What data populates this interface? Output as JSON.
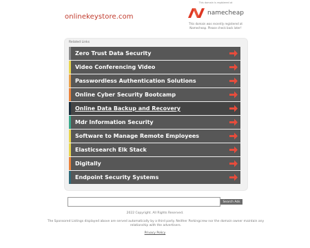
{
  "header": {
    "registrar_note": "This domain is registered at",
    "domain": "onlinekeystore.com",
    "brand_name": "namecheap",
    "recent_note": "This domain was recently registered at Namecheap. Please check back later!",
    "brand_color": "#de3723"
  },
  "related": {
    "title": "Related Links",
    "arrow_color": "#e74c3c",
    "links": [
      {
        "label": "Zero Trust Data Security",
        "stripe_color": "#8a8a8a"
      },
      {
        "label": "Video Conferencing Video",
        "stripe_color": "#e8d44d"
      },
      {
        "label": "Passwordless Authentication Solutions",
        "stripe_color": "#e9a24a"
      },
      {
        "label": "Online Cyber Security Bootcamp",
        "stripe_color": "#e9823a"
      },
      {
        "label": "Online Data Backup and Recovery",
        "stripe_color": "#1a2e3d"
      },
      {
        "label": "Mdr Information Security",
        "stripe_color": "#3aa88a"
      },
      {
        "label": "Software to Manage Remote Employees",
        "stripe_color": "#e8d44d"
      },
      {
        "label": "Elasticsearch Elk Stack",
        "stripe_color": "#e8d44d"
      },
      {
        "label": "Digitally",
        "stripe_color": "#e9823a"
      },
      {
        "label": "Endpoint Security Systems",
        "stripe_color": "#2d6a7a"
      }
    ],
    "active_index": 4
  },
  "search": {
    "placeholder": "",
    "button_label": "Search Ads"
  },
  "footer": {
    "copyright": "2022 Copyright. All Rights Reserved.",
    "disclaimer": "The Sponsored Listings displayed above are served automatically by a third party. Neither Parkingcrew nor the domain owner maintain any relationship with the advertisers.",
    "privacy_label": "Privacy Policy"
  }
}
